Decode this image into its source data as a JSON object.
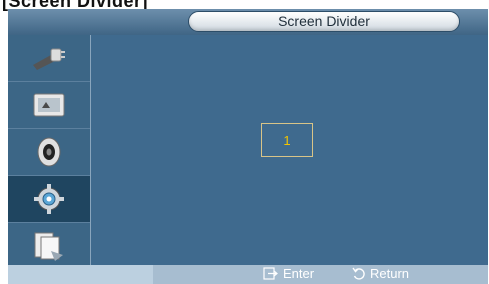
{
  "page": {
    "heading": "[Screen Divider]"
  },
  "osd": {
    "title": "Screen Divider",
    "sidebar": [
      {
        "icon": "input-plug-icon",
        "selected": false
      },
      {
        "icon": "picture-icon",
        "selected": false
      },
      {
        "icon": "speaker-icon",
        "selected": false
      },
      {
        "icon": "setup-gear-icon",
        "selected": true
      },
      {
        "icon": "multi-control-icon",
        "selected": false
      }
    ],
    "divider_cell": "1",
    "footer": {
      "enter_label": "Enter",
      "return_label": "Return"
    },
    "colors": {
      "frame": "#4d7595",
      "content": "#3f6a8e",
      "cell_number": "#f2c400"
    }
  }
}
